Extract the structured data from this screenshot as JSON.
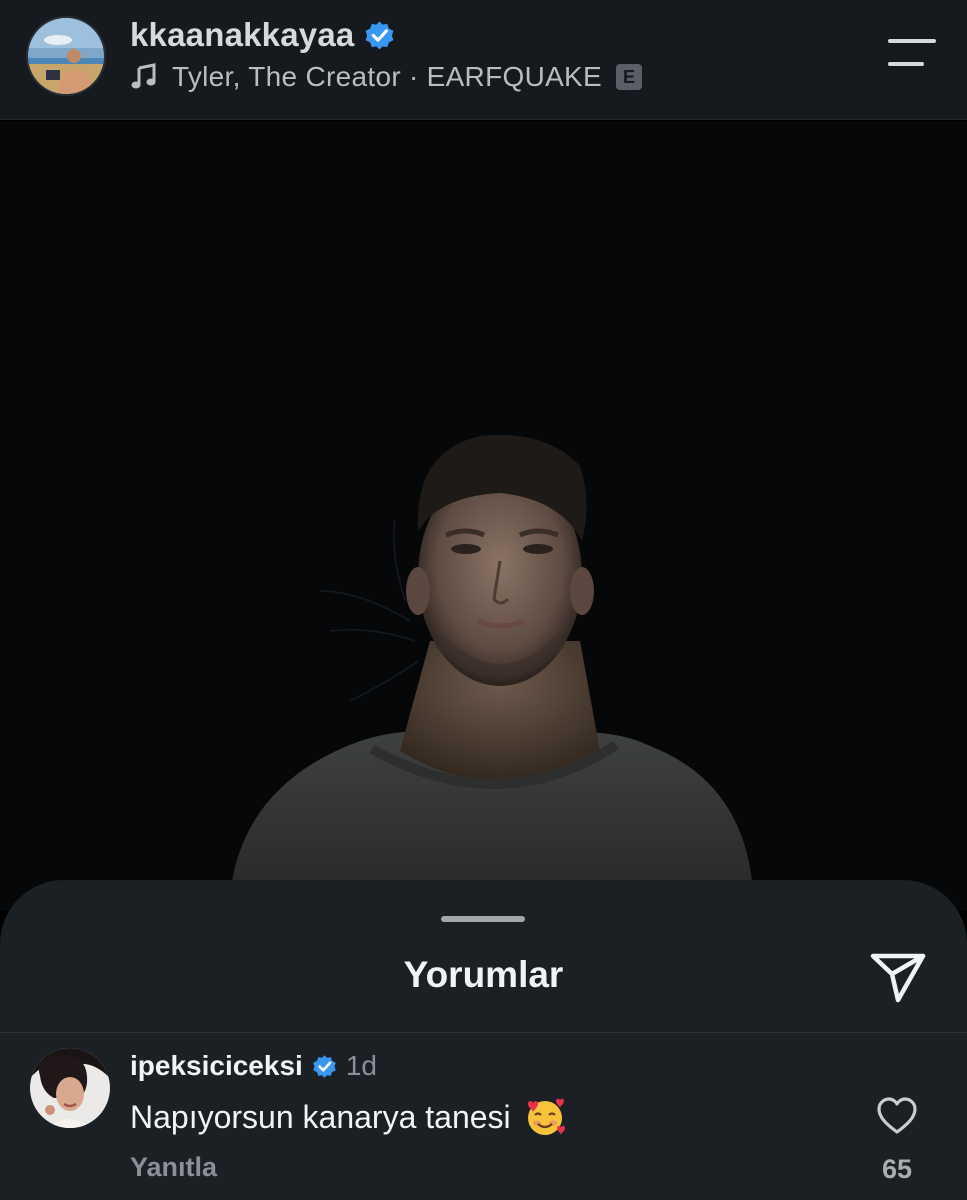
{
  "header": {
    "username": "kkaanakkayaa",
    "music": {
      "artist": "Tyler, The Creator",
      "separator": "·",
      "track": "EARFQUAKE",
      "explicit_badge": "E"
    },
    "icons": {
      "verified": "verified-badge-icon",
      "music": "music-note-icon",
      "menu": "menu-icon"
    }
  },
  "post": {
    "photo_description_icon": "portrait-photo"
  },
  "comments_sheet": {
    "title": "Yorumlar",
    "share_icon": "send-icon",
    "comments": [
      {
        "username": "ipeksiciceksi",
        "time": "1d",
        "text": "Napıyorsun kanarya tanesi",
        "emoji_icon": "smiling-face-with-hearts-icon",
        "reply_label": "Yanıtla",
        "like_count": "65"
      }
    ]
  },
  "colors": {
    "verified_blue": "#3897f0",
    "sheet_bg": "#1b2025",
    "header_bg": "#161a1e"
  }
}
